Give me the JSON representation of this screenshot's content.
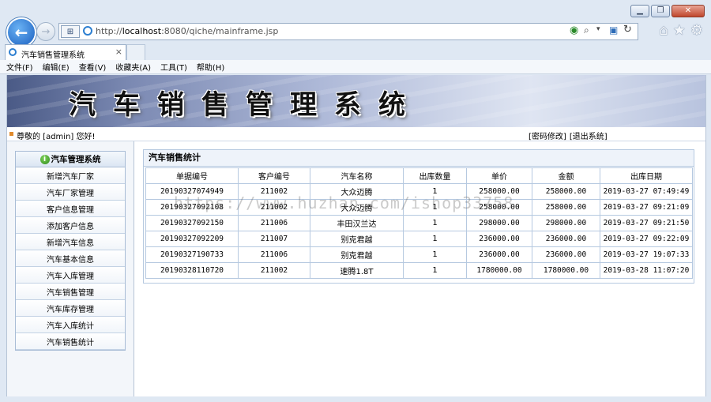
{
  "browser": {
    "url_prefix": "http://",
    "url_host": "localhost",
    "url_rest": ":8080/qiche/mainframe.jsp",
    "tab_title": "汽车销售管理系统",
    "tab_close": "×",
    "back_glyph": "←",
    "fwd_glyph": "→",
    "window_buttons": {
      "minimize": "▁",
      "restore": "❐",
      "close": "✕"
    },
    "right_icons": [
      "home-icon",
      "favorites-icon",
      "settings-icon"
    ],
    "menu": [
      "文件(F)",
      "编辑(E)",
      "查看(V)",
      "收藏夹(A)",
      "工具(T)",
      "帮助(H)"
    ]
  },
  "app": {
    "banner_title": "汽车销售管理系统",
    "greeting": "尊敬的 [admin] 您好!",
    "change_password": "[密码修改]",
    "logout": "[退出系统]"
  },
  "sidebar": {
    "header": "汽车管理系统",
    "items": [
      "新增汽车厂家",
      "汽车厂家管理",
      "客户信息管理",
      "添加客户信息",
      "新增汽车信息",
      "汽车基本信息",
      "汽车入库管理",
      "汽车销售管理",
      "汽车库存管理",
      "汽车入库统计",
      "汽车销售统计"
    ]
  },
  "main": {
    "title": "汽车销售统计",
    "columns": [
      "单据编号",
      "客户编号",
      "汽车名称",
      "出库数量",
      "单价",
      "金额",
      "出库日期"
    ],
    "rows": [
      [
        "20190327074949",
        "211002",
        "大众迈腾",
        "1",
        "258000.00",
        "258000.00",
        "2019-03-27 07:49:49"
      ],
      [
        "20190327092108",
        "211002",
        "大众迈腾",
        "1",
        "258000.00",
        "258000.00",
        "2019-03-27 09:21:09"
      ],
      [
        "20190327092150",
        "211006",
        "丰田汉兰达",
        "1",
        "298000.00",
        "298000.00",
        "2019-03-27 09:21:50"
      ],
      [
        "20190327092209",
        "211007",
        "别克君越",
        "1",
        "236000.00",
        "236000.00",
        "2019-03-27 09:22:09"
      ],
      [
        "20190327190733",
        "211006",
        "别克君越",
        "1",
        "236000.00",
        "236000.00",
        "2019-03-27 19:07:33"
      ],
      [
        "20190328110720",
        "211002",
        "速腾1.8T",
        "1",
        "1780000.00",
        "1780000.00",
        "2019-03-28 11:07:20"
      ]
    ]
  },
  "watermark": "https://www.huzhan.com/ishop33758",
  "colors": {
    "accent": "#2d7fd1",
    "border": "#b6c9e0",
    "banner_dark": "#4a5a86"
  }
}
